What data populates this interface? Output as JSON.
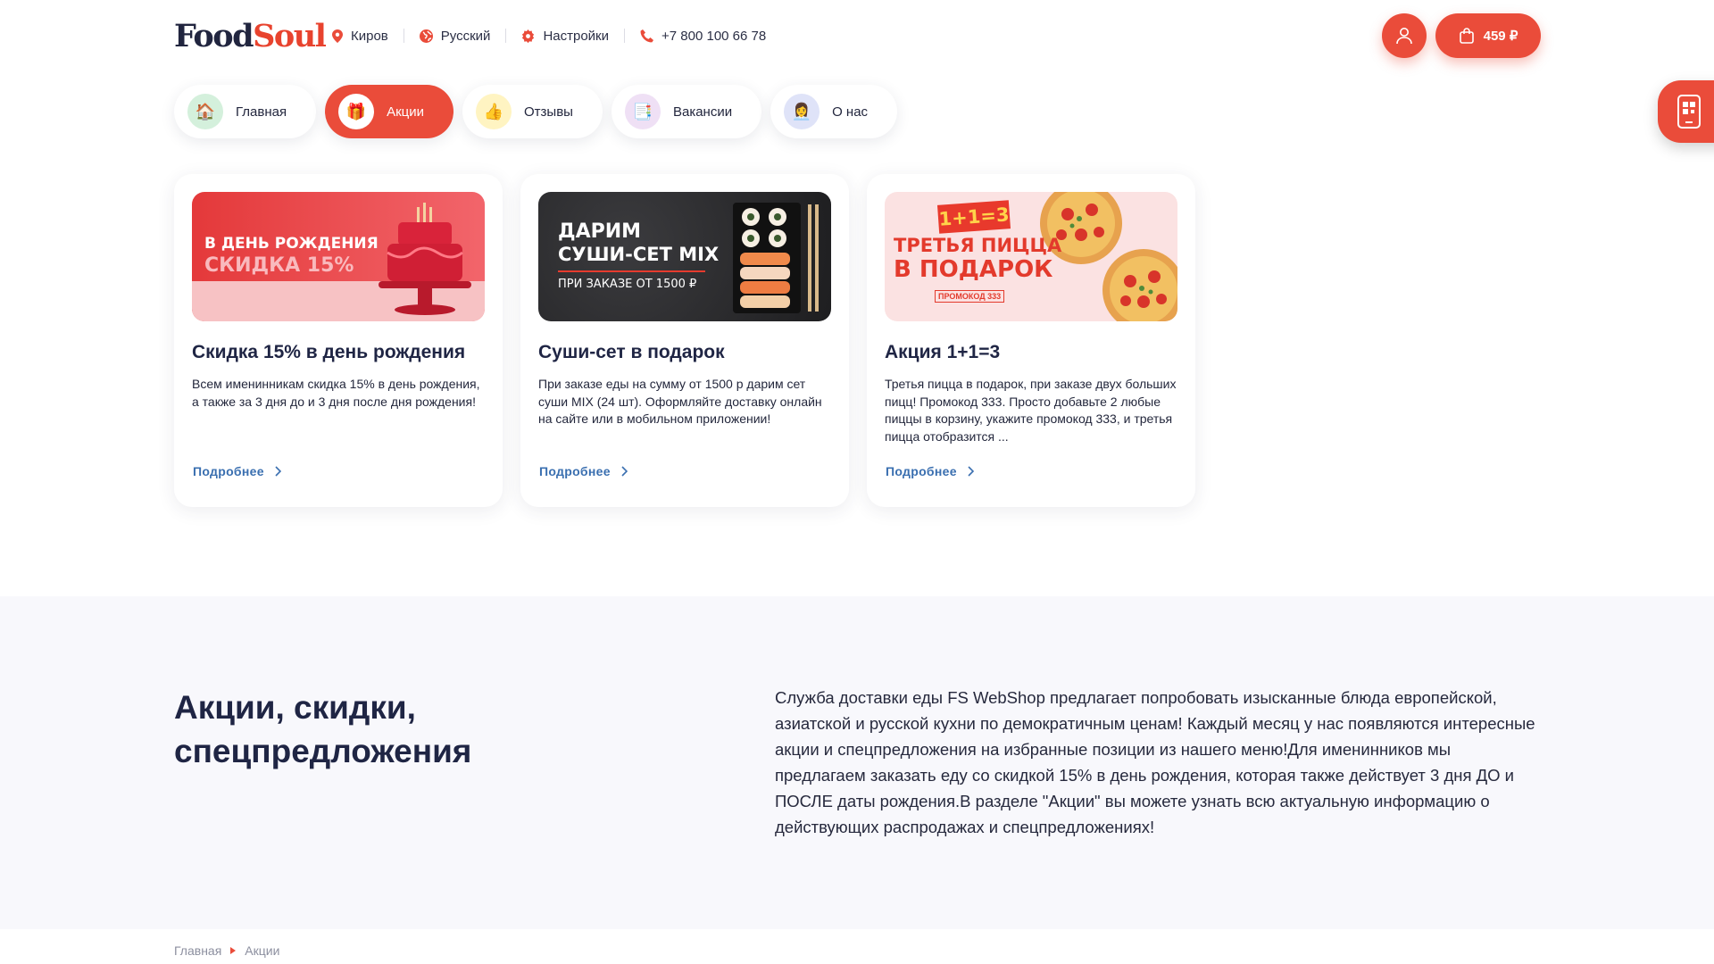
{
  "header": {
    "logo_food": "Food",
    "logo_soul": "Soul",
    "city": "Киров",
    "language": "Русский",
    "settings": "Настройки",
    "phone": "+7 800 100 66 78",
    "cart_total": "459 ₽"
  },
  "menu": [
    {
      "label": "Главная",
      "icon": "home-icon",
      "emoji": "🏠",
      "bg": "#d4f0dc"
    },
    {
      "label": "Акции",
      "icon": "gift-icon",
      "emoji": "🎁",
      "bg": "#ffffff"
    },
    {
      "label": "Отзывы",
      "icon": "thumbs-up-icon",
      "emoji": "👍",
      "bg": "#fff4c2"
    },
    {
      "label": "Вакансии",
      "icon": "document-icon",
      "emoji": "📑",
      "bg": "#efe0f5"
    },
    {
      "label": "О нас",
      "icon": "person-icon",
      "emoji": "👩‍💼",
      "bg": "#dfe3f8"
    }
  ],
  "cards": [
    {
      "banner": {
        "line1": "В ДЕНЬ РОЖДЕНИЯ",
        "line2": "СКИДКА 15%"
      },
      "title": "Скидка 15% в день рождения",
      "text": "Всем именинникам скидка 15% в день рождения, а также за 3 дня до и 3 дня после дня рождения!",
      "more": "Подробнее"
    },
    {
      "banner": {
        "line1": "ДАРИМ",
        "line2": "СУШИ-СЕТ MIX",
        "line3": "ПРИ ЗАКАЗЕ ОТ 1500 ₽"
      },
      "title": "Суши-сет в подарок",
      "text": "При заказе еды на сумму от 1500 р дарим сет суши MIX (24 шт). Оформляйте доставку онлайн на сайте или в мобильном приложении!",
      "more": "Подробнее"
    },
    {
      "banner": {
        "badge": "1+1=3",
        "line1": "ТРЕТЬЯ ПИЦЦА",
        "line2": "В ПОДАРОК",
        "code": "ПРОМОКОД 333"
      },
      "title": "Акция 1+1=3",
      "text": "Третья пицца в подарок, при заказе двух больших пицц! Промокод 333. Просто добавьте 2 любые пиццы в корзину, укажите промокод 333, и третья пицца отобразится ...",
      "more": "Подробнее"
    }
  ],
  "seo": {
    "title": "Акции, скидки, спецпредложения",
    "text": "Служба доставки еды FS WebShop предлагает попробовать изысканные блюда европейской, азиатской и русской кухни по демократичным ценам! Каждый месяц у нас появляются интересные акции и спецпредложения на избранные позиции из нашего меню!Для именинников мы предлагаем заказать еду со скидкой 15% в день рождения, которая также действует 3 дня ДО и ПОСЛЕ даты рождения.В разделе \"Акции\" вы можете узнать всю актуальную информацию о действующих распродажах и спецпредложениях!"
  },
  "breadcrumb": {
    "home": "Главная",
    "current": "Акции"
  },
  "colors": {
    "accent": "#ea4c3a",
    "text": "#1f2544",
    "link": "#3a6fb0"
  }
}
